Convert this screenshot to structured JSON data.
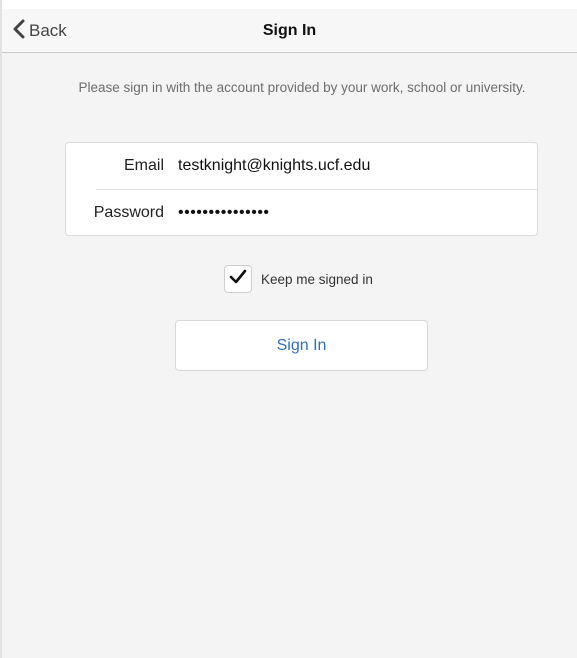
{
  "navbar": {
    "back_label": "Back",
    "title": "Sign In",
    "back_icon": "chevron-left-icon"
  },
  "instructions": {
    "text": "Please sign in with the account provided by your work, school or university."
  },
  "form": {
    "email_label": "Email",
    "email_value": "testknight@knights.ucf.edu",
    "password_label": "Password",
    "password_mask": "•••••••••••••••"
  },
  "keep_signed_in": {
    "label": "Keep me signed in",
    "checked": true,
    "icon": "checkmark-icon"
  },
  "signin_button": {
    "label": "Sign In"
  },
  "colors": {
    "accent": "#2f6fb7",
    "background": "#f4f4f4"
  }
}
